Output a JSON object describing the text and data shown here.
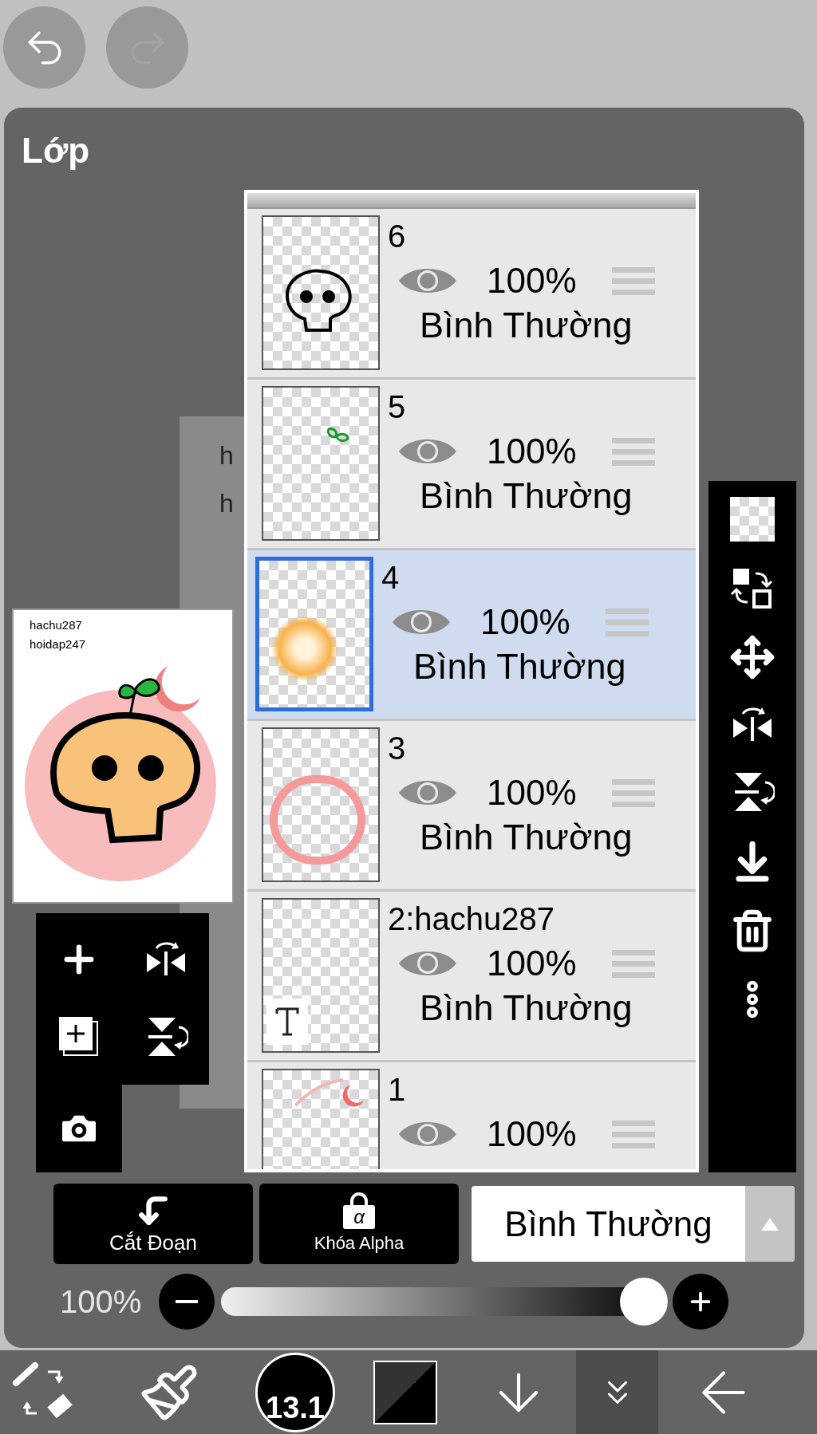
{
  "history_buttons": [
    {
      "kind": "undo",
      "disabled": false
    },
    {
      "kind": "redo",
      "disabled": true
    }
  ],
  "panel": {
    "title": "Lớp"
  },
  "canvas_text": [
    "h",
    "h"
  ],
  "preview": {
    "lines": [
      "hachu287",
      "hoidap247"
    ]
  },
  "layers": [
    {
      "name": "6",
      "kind": "skull",
      "visible": true,
      "opacity": "100%",
      "blend": "Bình Thường",
      "selected": false
    },
    {
      "name": "5",
      "kind": "sprout",
      "visible": true,
      "opacity": "100%",
      "blend": "Bình Thường",
      "selected": false
    },
    {
      "name": "4",
      "kind": "glow",
      "visible": true,
      "opacity": "100%",
      "blend": "Bình Thường",
      "selected": true
    },
    {
      "name": "3",
      "kind": "ring",
      "visible": true,
      "opacity": "100%",
      "blend": "Bình Thường",
      "selected": false
    },
    {
      "name": "2:hachu287",
      "kind": "text",
      "visible": true,
      "opacity": "100%",
      "blend": "Bình Thường",
      "selected": false
    },
    {
      "name": "1",
      "kind": "moon",
      "visible": true,
      "opacity": "100%",
      "selected": false
    }
  ],
  "buttons": [
    {
      "kind": "clip",
      "label": "Cắt Đoạn"
    },
    {
      "kind": "alpha_lock",
      "label": "Khóa Alpha",
      "icon_text": "α"
    }
  ],
  "blend_mode": {
    "value": "Bình Thường"
  },
  "opacity": {
    "reading": "100%",
    "level": 1.0
  },
  "brush_size": "13.1"
}
